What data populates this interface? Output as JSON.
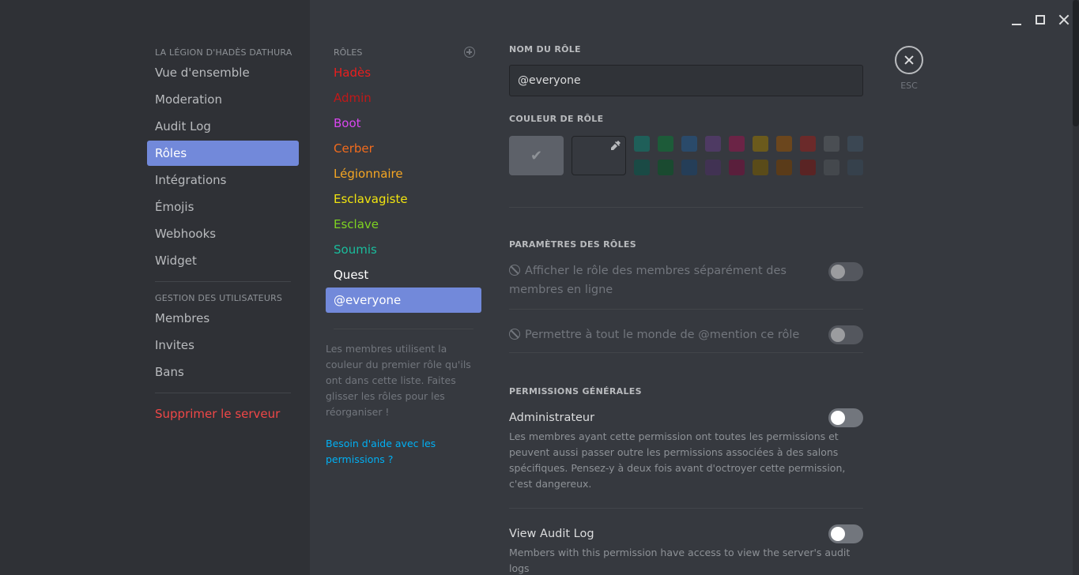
{
  "sidebar": {
    "server_header": "LA LÉGION D'HADÈS DATHURA",
    "items": [
      {
        "label": "Vue d'ensemble"
      },
      {
        "label": "Moderation"
      },
      {
        "label": "Audit Log"
      },
      {
        "label": "Rôles"
      },
      {
        "label": "Intégrations"
      },
      {
        "label": "Émojis"
      },
      {
        "label": "Webhooks"
      },
      {
        "label": "Widget"
      }
    ],
    "user_header": "GESTION DES UTILISATEURS",
    "user_items": [
      {
        "label": "Membres"
      },
      {
        "label": "Invites"
      },
      {
        "label": "Bans"
      }
    ],
    "delete_label": "Supprimer le serveur"
  },
  "roles": {
    "header": "RÔLES",
    "items": [
      {
        "label": "Hadès",
        "color": "#e91e1e"
      },
      {
        "label": "Admin",
        "color": "#c01818"
      },
      {
        "label": "Boot",
        "color": "#d946ef"
      },
      {
        "label": "Cerber",
        "color": "#f26b1d"
      },
      {
        "label": "Légionnaire",
        "color": "#f5a623"
      },
      {
        "label": "Esclavagiste",
        "color": "#f1e40f"
      },
      {
        "label": "Esclave",
        "color": "#7ed321"
      },
      {
        "label": "Soumis",
        "color": "#1abc9c"
      },
      {
        "label": "Quest",
        "color": "#ffffff"
      },
      {
        "label": "@everyone",
        "color": "#ffffff"
      }
    ],
    "note": "Les membres utilisent la couleur du premier rôle qu'ils ont dans cette liste. Faites glisser les rôles pour les réorganiser !",
    "help_link": "Besoin d'aide avec les permissions ?"
  },
  "content": {
    "name_label": "NOM DU RÔLE",
    "name_value": "@everyone",
    "color_label": "COULEUR DE RÔLE",
    "default_check": "✔",
    "swatch_colors": [
      "#1f5f59",
      "#1d5b39",
      "#2a4a6a",
      "#4e3a63",
      "#6b2446",
      "#6b5a1c",
      "#6b461d",
      "#6b2a2a",
      "#4a4e53",
      "#3b4753",
      "#1a4a45",
      "#1a4a30",
      "#253e58",
      "#413253",
      "#5a1f3c",
      "#5a4b19",
      "#5a3b19",
      "#5a2424",
      "#44484d",
      "#36414c"
    ],
    "role_settings_label": "PARAMÈTRES DES RÔLES",
    "setting_1": "Afficher le rôle des membres séparément des membres en ligne",
    "setting_2": "Permettre à tout le monde de @mention ce rôle",
    "general_perms_label": "PERMISSIONS GÉNÉRALES",
    "admin_title": "Administrateur",
    "admin_desc": "Les membres ayant cette permission ont toutes les permissions et peuvent aussi passer outre les permissions associées à des salons spécifiques. Pensez-y à deux fois avant d'octroyer cette permission, c'est dangereux.",
    "audit_title": "View Audit Log",
    "audit_desc": "Members with this permission have access to view the server's audit logs"
  },
  "close": {
    "esc_label": "ESC"
  },
  "colors": {
    "accent": "#7289da",
    "danger": "#f04747",
    "link": "#00b0f4"
  }
}
